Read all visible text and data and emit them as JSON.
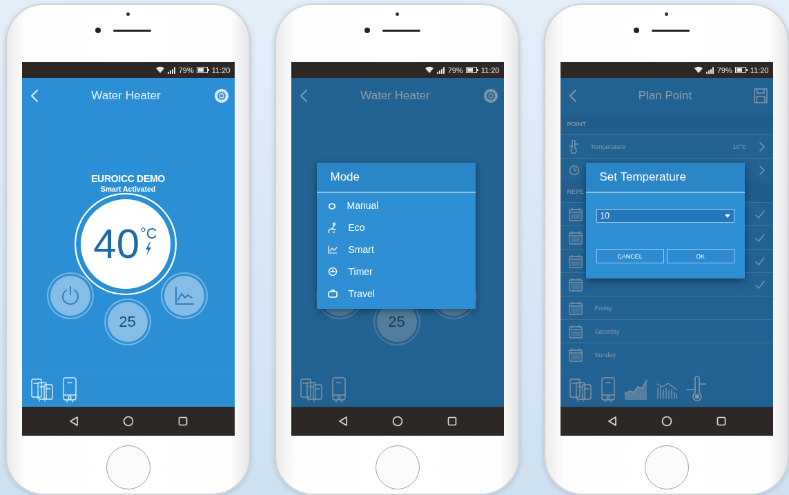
{
  "phones": [
    {
      "kind": "home",
      "dimmed": false,
      "status_bar": {
        "battery": "79%",
        "time": "11:20"
      },
      "app_bar": {
        "title": "Water Heater"
      },
      "device": {
        "name": "EUROICC DEMO",
        "status": "Smart Activated"
      },
      "temperature": {
        "value": "40",
        "unit": "°C"
      },
      "setpoint": "25"
    },
    {
      "kind": "home",
      "dimmed": true,
      "status_bar": {
        "battery": "79%",
        "time": "11:20"
      },
      "app_bar": {
        "title": "Water Heater"
      },
      "setpoint": "25",
      "dialog": {
        "kind": "menu",
        "title": "Mode",
        "items": [
          {
            "label": "Manual"
          },
          {
            "label": "Eco"
          },
          {
            "label": "Smart"
          },
          {
            "label": "Timer"
          },
          {
            "label": "Travel"
          }
        ]
      }
    },
    {
      "kind": "plan",
      "dimmed": true,
      "status_bar": {
        "battery": "79%",
        "time": "11:20"
      },
      "app_bar": {
        "title": "Plan Point"
      },
      "sections": [
        {
          "header": "POINT",
          "rows": [
            {
              "label": "Temperature",
              "value": "10°C"
            },
            {}
          ]
        },
        {
          "header": "REPE",
          "rows": [
            {
              "checked": true
            },
            {
              "checked": true
            },
            {
              "checked": true
            },
            {
              "checked": true
            },
            {
              "label": "Friday",
              "checked": false
            },
            {
              "label": "Saturday",
              "checked": false
            },
            {
              "label": "Sunday",
              "checked": false
            }
          ]
        }
      ],
      "dialog": {
        "kind": "prompt",
        "title": "Set Temperature",
        "value": "10",
        "buttons": [
          "CANCEL",
          "OK"
        ]
      }
    }
  ]
}
